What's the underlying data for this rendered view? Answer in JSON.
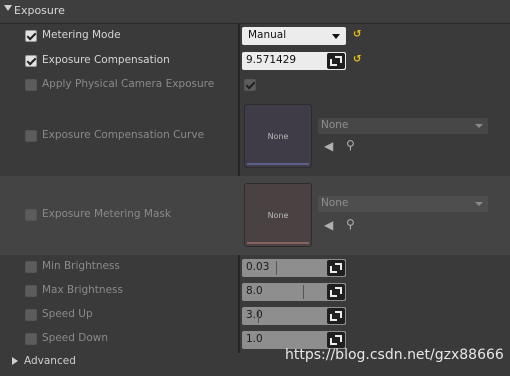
{
  "section": {
    "title": "Exposure"
  },
  "metering_mode": {
    "label": "Metering Mode",
    "value": "Manual"
  },
  "exposure_compensation": {
    "label": "Exposure Compensation",
    "value": "9.571429"
  },
  "apply_physical": {
    "label": "Apply Physical Camera Exposure"
  },
  "comp_curve": {
    "label": "Exposure Compensation Curve",
    "thumb": "None",
    "asset": "None"
  },
  "metering_mask": {
    "label": "Exposure Metering Mask",
    "thumb": "None",
    "asset": "None"
  },
  "min_brightness": {
    "label": "Min Brightness",
    "value": "0.03"
  },
  "max_brightness": {
    "label": "Max Brightness",
    "value": "8.0"
  },
  "speed_up": {
    "label": "Speed Up",
    "value": "3.0"
  },
  "speed_down": {
    "label": "Speed Down",
    "value": "1.0"
  },
  "advanced": {
    "label": "Advanced"
  },
  "watermark": "https://blog.csdn.net/gzx88666",
  "colors": {
    "accent_reset": "#f0c31b",
    "panel_bg": "#3a3a3a",
    "mask_row_bg": "#444444"
  }
}
